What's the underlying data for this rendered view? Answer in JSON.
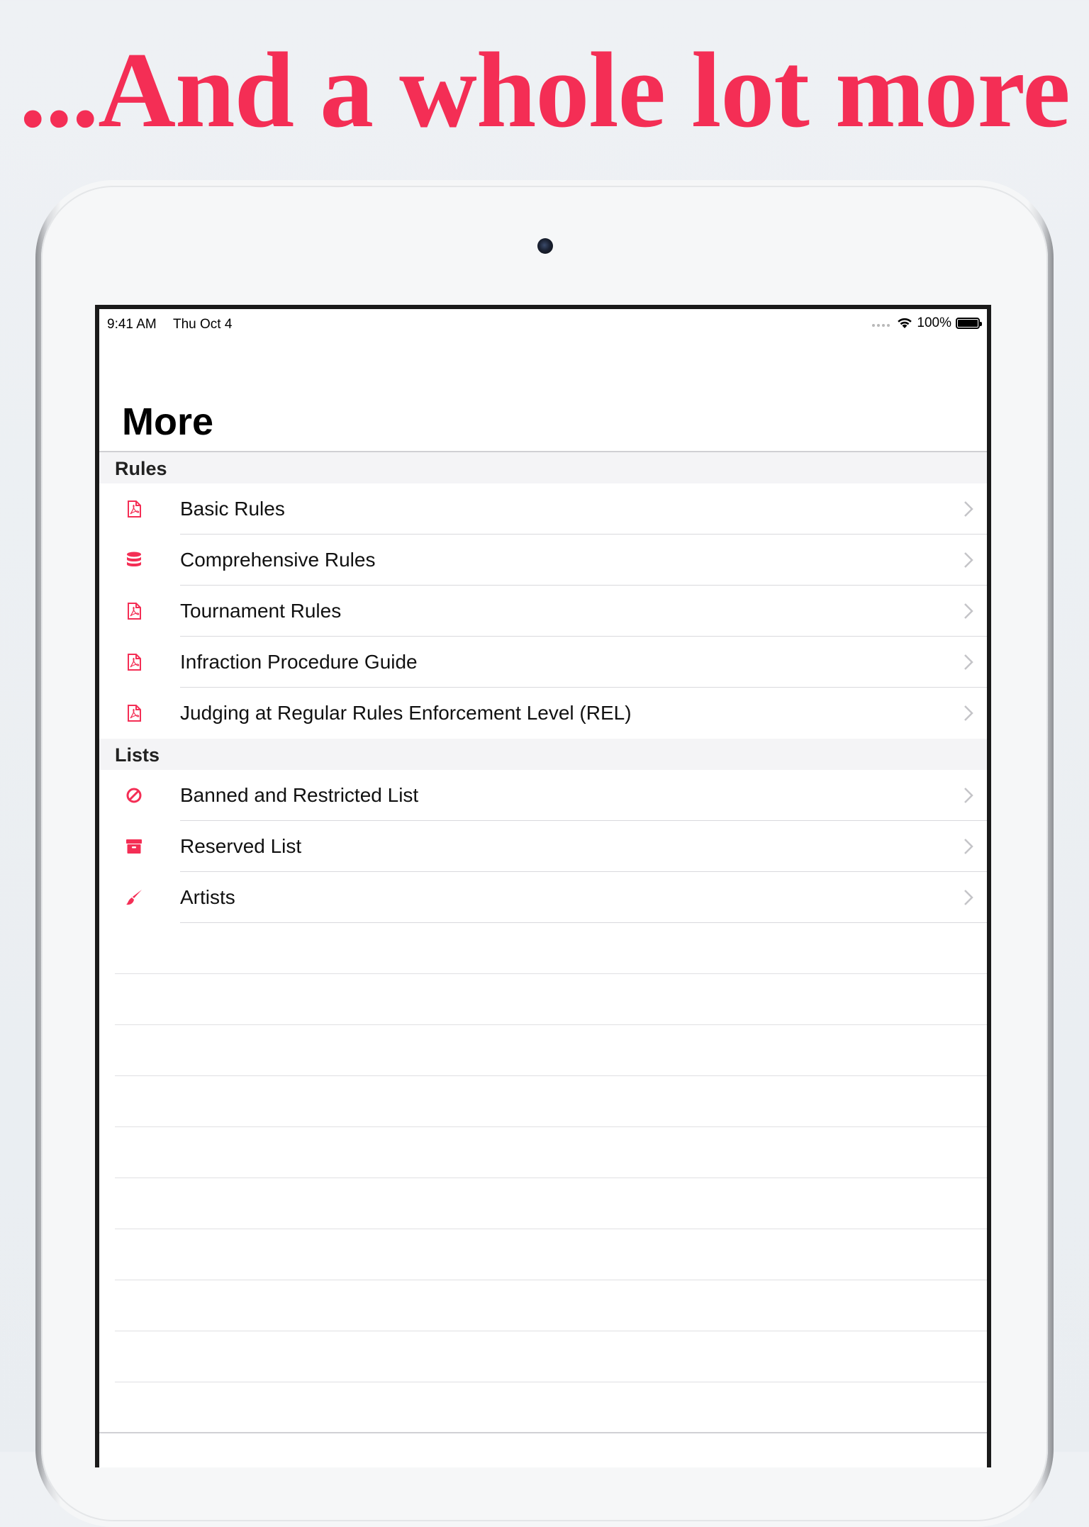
{
  "headline": "...And a whole lot more",
  "status_bar": {
    "time": "9:41 AM",
    "date": "Thu Oct 4",
    "battery": "100%"
  },
  "page_title": "More",
  "sections": [
    {
      "title": "Rules",
      "items": [
        {
          "label": "Basic Rules",
          "icon": "pdf-icon"
        },
        {
          "label": "Comprehensive Rules",
          "icon": "database-icon"
        },
        {
          "label": "Tournament Rules",
          "icon": "pdf-icon"
        },
        {
          "label": "Infraction Procedure Guide",
          "icon": "pdf-icon"
        },
        {
          "label": "Judging at Regular Rules Enforcement Level (REL)",
          "icon": "pdf-icon"
        }
      ]
    },
    {
      "title": "Lists",
      "items": [
        {
          "label": "Banned and Restricted List",
          "icon": "prohibited-icon"
        },
        {
          "label": "Reserved List",
          "icon": "archive-box-icon"
        },
        {
          "label": "Artists",
          "icon": "paintbrush-icon"
        }
      ]
    }
  ],
  "colors": {
    "accent": "#f42e55",
    "headline": "#f42e55"
  }
}
